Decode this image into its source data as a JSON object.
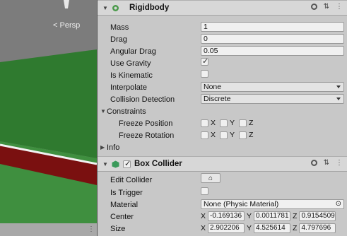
{
  "scene": {
    "view_label": "Persp"
  },
  "rigidbody": {
    "title": "Rigidbody",
    "mass": {
      "label": "Mass",
      "value": "1"
    },
    "drag": {
      "label": "Drag",
      "value": "0"
    },
    "angular_drag": {
      "label": "Angular Drag",
      "value": "0.05"
    },
    "use_gravity": {
      "label": "Use Gravity",
      "checked": true
    },
    "is_kinematic": {
      "label": "Is Kinematic",
      "checked": false
    },
    "interpolate": {
      "label": "Interpolate",
      "value": "None"
    },
    "collision_detection": {
      "label": "Collision Detection",
      "value": "Discrete"
    },
    "constraints": {
      "label": "Constraints",
      "freeze_position": {
        "label": "Freeze Position",
        "axes": [
          "X",
          "Y",
          "Z"
        ]
      },
      "freeze_rotation": {
        "label": "Freeze Rotation",
        "axes": [
          "X",
          "Y",
          "Z"
        ]
      }
    },
    "info": {
      "label": "Info"
    }
  },
  "box_collider": {
    "title": "Box Collider",
    "enabled": true,
    "edit_collider": {
      "label": "Edit Collider"
    },
    "is_trigger": {
      "label": "Is Trigger",
      "checked": false
    },
    "material": {
      "label": "Material",
      "value": "None (Physic Material)"
    },
    "center": {
      "label": "Center",
      "x": "-0.169136",
      "y": "0.0011781",
      "z": "0.9154509"
    },
    "size": {
      "label": "Size",
      "x": "2.902206",
      "y": "4.525614",
      "z": "4.797696"
    }
  },
  "colors": {
    "ground_green": "#2e7a2e",
    "wall_red": "#7a1010",
    "sky_gray": "#7c7c7c",
    "inspector_bg": "#c8c8c8"
  },
  "icons": [
    "rigidbody-icon",
    "box-collider-icon",
    "help-icon",
    "settings-icon",
    "more-icon",
    "edit-collider-icon",
    "object-picker-icon"
  ]
}
